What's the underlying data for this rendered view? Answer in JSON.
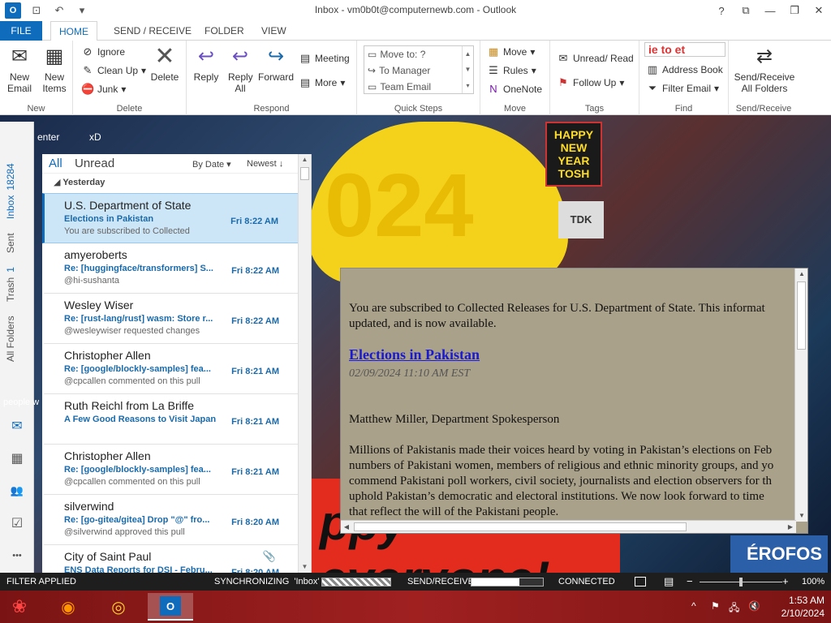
{
  "window": {
    "title": "Inbox - vm0b0t@computernewb.com - Outlook",
    "help": "?",
    "ribbon_toggle": "⧉",
    "minimize": "—",
    "restore": "❐",
    "close": "✕"
  },
  "qat": {
    "app_icon": "O",
    "send_icon": "⊡",
    "undo_icon": "↶",
    "more_icon": "▾"
  },
  "tabs": [
    "FILE",
    "HOME",
    "SEND / RECEIVE",
    "FOLDER",
    "VIEW"
  ],
  "ribbon": {
    "new": {
      "new_email": "New Email",
      "new_items": "New Items",
      "group": "New"
    },
    "delete": {
      "ignore": "Ignore",
      "clean_up": "Clean Up",
      "junk": "Junk",
      "delete": "Delete",
      "group": "Delete"
    },
    "respond": {
      "reply": "Reply",
      "reply_all": "Reply All",
      "forward": "Forward",
      "meeting": "Meeting",
      "more": "More",
      "group": "Respond"
    },
    "quick_steps": {
      "items": [
        "Move to: ?",
        "To Manager",
        "Team Email"
      ],
      "group": "Quick Steps"
    },
    "move": {
      "move": "Move",
      "rules": "Rules",
      "onenote": "OneNote",
      "group": "Move"
    },
    "tags": {
      "unread_read": "Unread/ Read",
      "follow_up": "Follow Up",
      "group": "Tags"
    },
    "find": {
      "search_text": "ie to et",
      "address_book": "Address Book",
      "filter_email": "Filter Email",
      "group": "Find"
    },
    "send_receive": {
      "label": "Send/Receive All Folders",
      "group": "Send/Receive"
    }
  },
  "desktop": {
    "label_center": "enter",
    "label_xd": "xD",
    "label_people": "people w",
    "sign_text": "HAPPY NEW YEAR",
    "sign_sub": "TOSH",
    "bg_big": "024",
    "bg_red": "ppy everyone!",
    "bg_right": "ÉROFOS",
    "bg_tdk": "TDK"
  },
  "nav": {
    "inbox": "Inbox",
    "inbox_count": "18284",
    "sent": "Sent",
    "trash": "Trash",
    "trash_count": "1",
    "all_folders": "All Folders",
    "mail_icon": "✉",
    "calendar_icon": "▦",
    "people_icon": "👥",
    "tasks_icon": "☑",
    "more_icon": "•••"
  },
  "list": {
    "filter_all": "All",
    "filter_unread": "Unread",
    "sort_by": "By Date ▾",
    "sort_order": "Newest ↓",
    "group_header": "Yesterday",
    "messages": [
      {
        "from": "U.S. Department of State",
        "subject": "Elections in Pakistan",
        "time": "Fri 8:22 AM",
        "preview": "You are subscribed to Collected"
      },
      {
        "from": "amyeroberts",
        "subject": "Re: [huggingface/transformers] S...",
        "time": "Fri 8:22 AM",
        "preview": "@hi-sushanta"
      },
      {
        "from": "Wesley Wiser",
        "subject": "Re: [rust-lang/rust] wasm: Store r...",
        "time": "Fri 8:22 AM",
        "preview": "@wesleywiser requested changes"
      },
      {
        "from": "Christopher Allen",
        "subject": "Re: [google/blockly-samples] fea...",
        "time": "Fri 8:21 AM",
        "preview": "@cpcallen commented on this pull"
      },
      {
        "from": "Ruth Reichl from La Briffe",
        "subject": "A Few Good Reasons to Visit Japan",
        "time": "Fri 8:21 AM",
        "preview": ""
      },
      {
        "from": "Christopher Allen",
        "subject": "Re: [google/blockly-samples] fea...",
        "time": "Fri 8:21 AM",
        "preview": "@cpcallen commented on this pull"
      },
      {
        "from": "silverwind",
        "subject": "Re: [go-gitea/gitea] Drop \"@\" fro...",
        "time": "Fri 8:20 AM",
        "preview": "@silverwind approved this pull"
      },
      {
        "from": "City of Saint Paul",
        "subject": "ENS Data Reports for DSI - Febru...",
        "time": "Fri 8:20 AM",
        "preview": ""
      }
    ]
  },
  "reading": {
    "intro_1": "You are subscribed to Collected Releases for U.S. Department of State. This informat",
    "intro_2": "updated, and is now available.",
    "link": "Elections in Pakistan",
    "datetime": "02/09/2024 11:10 AM EST",
    "speaker": "Matthew Miller, Department Spokesperson",
    "p1": "Millions of Pakistanis made their voices heard by voting in Pakistan’s elections on Feb",
    "p2": "numbers of Pakistani women, members of religious and ethnic minority groups, and yo",
    "p3": "commend Pakistani poll workers, civil society, journalists and election observers for th",
    "p4": "uphold Pakistan’s democratic and electoral institutions. We now look forward to time",
    "p5": "that reflect the will of the Pakistani people."
  },
  "status": {
    "filter": "FILTER APPLIED",
    "sync": "SYNCHRONIZING  'Inbox'",
    "send_receive": "SEND/RECEIVE",
    "connected": "CONNECTED",
    "zoom": "100%",
    "zoom_minus": "−",
    "zoom_plus": "+",
    "send_receive_progress": 0.67,
    "zoom_level": 0.5
  },
  "taskbar": {
    "time": "1:53 AM",
    "date": "2/10/2024",
    "outlook_icon": "O",
    "tray_arrow": "^",
    "tray_flag": "⚑",
    "tray_net": "🖧",
    "tray_vol": "🔇"
  },
  "colors": {
    "accent": "#0f6cbd",
    "selected": "#cde6f7",
    "status_bar": "#1e1e1e",
    "taskbar": "#8a1e1e",
    "reading_bg": "#aaa18a"
  }
}
